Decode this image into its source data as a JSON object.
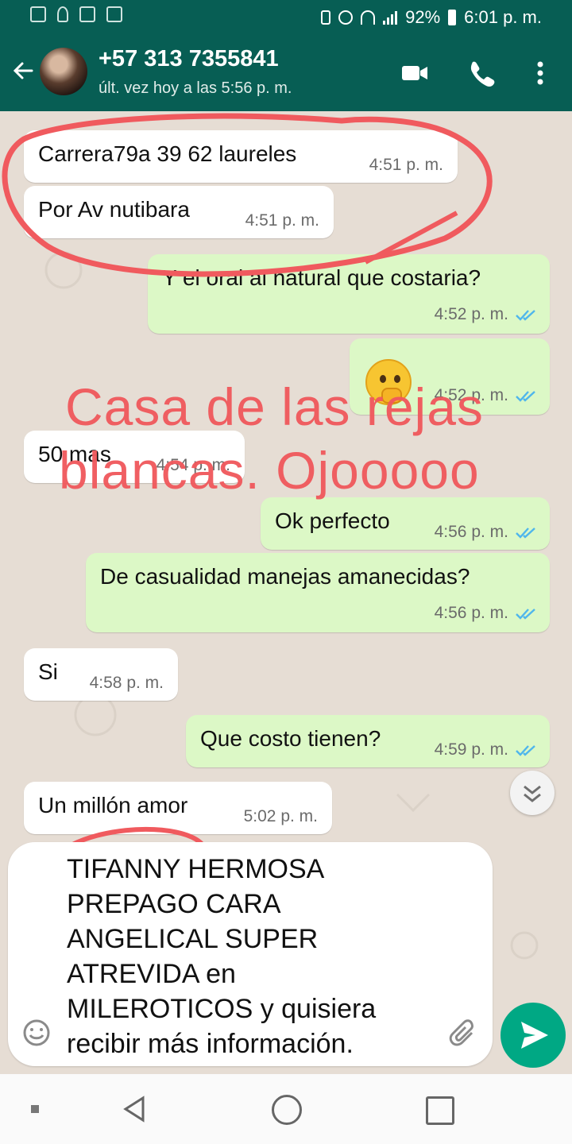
{
  "status_bar": {
    "battery": "92%",
    "time": "6:01 p. m."
  },
  "contact": {
    "name": "+57 313 7355841",
    "last_seen": "últ. vez hoy a las 5:56 p. m."
  },
  "messages": [
    {
      "dir": "in",
      "text": "Carrera79a 39 62 laureles",
      "time": "4:51 p. m."
    },
    {
      "dir": "in",
      "text": "Por Av nutibara",
      "time": "4:51 p. m."
    },
    {
      "dir": "out",
      "text": "Y el oral al natural que costaria?",
      "time": "4:52 p. m."
    },
    {
      "dir": "out",
      "text": "",
      "emoji": "thinking-face",
      "time": "4:52 p. m."
    },
    {
      "dir": "in",
      "text": "50 mas",
      "time": "4:54 p. m."
    },
    {
      "dir": "out",
      "text": "Ok perfecto",
      "time": "4:56 p. m."
    },
    {
      "dir": "out",
      "text": "De casualidad manejas amanecidas?",
      "time": "4:56 p. m."
    },
    {
      "dir": "in",
      "text": "Si",
      "time": "4:58 p. m."
    },
    {
      "dir": "out",
      "text": "Que costo tienen?",
      "time": "4:59 p. m."
    },
    {
      "dir": "in",
      "text": "Un millón amor",
      "time": "5:02 p. m."
    }
  ],
  "overlay": {
    "line1": "Casa de las rejas",
    "line2": "blancas. Ojooooo"
  },
  "composer": {
    "text": "TIFANNY HERMOSA\nPREPAGO CARA\nANGELICAL SUPER\nATREVIDA en\nMILEROTICOS y quisiera\nrecibir más información."
  },
  "colors": {
    "header": "#075e54",
    "incoming": "#ffffff",
    "outgoing": "#dcf8c6",
    "send": "#00a884",
    "annotation": "#f05a5e",
    "read_ticks": "#4fb6ec"
  }
}
